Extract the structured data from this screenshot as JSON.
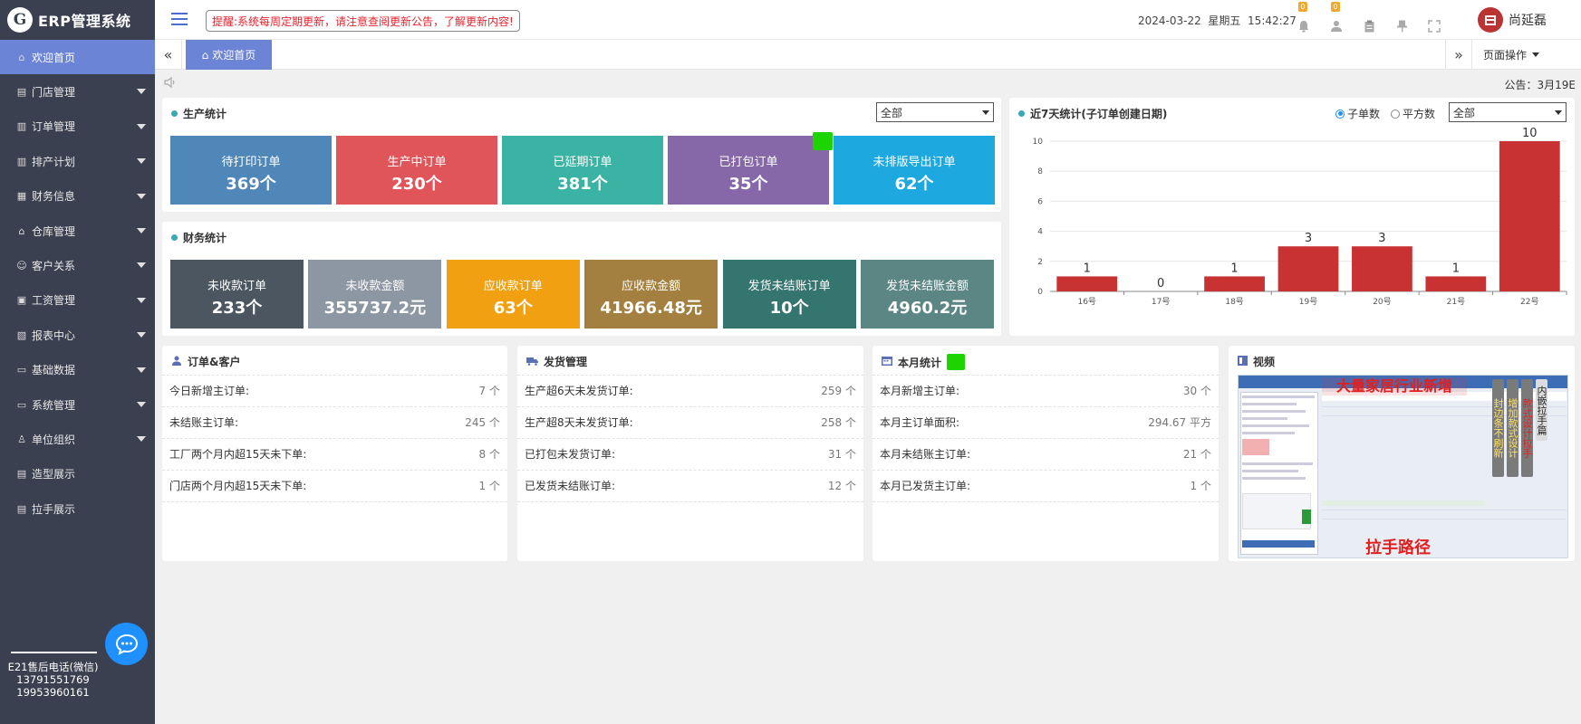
{
  "brand": {
    "logo_mark": "G",
    "name": "ERP管理系统"
  },
  "sidebar": {
    "items": [
      {
        "label": "欢迎首页",
        "icon": "home-icon",
        "active": true,
        "has_caret": false
      },
      {
        "label": "门店管理",
        "icon": "store-icon",
        "active": false,
        "has_caret": true
      },
      {
        "label": "订单管理",
        "icon": "document-icon",
        "active": false,
        "has_caret": true
      },
      {
        "label": "排产计划",
        "icon": "document-icon",
        "active": false,
        "has_caret": true
      },
      {
        "label": "财务信息",
        "icon": "finance-icon",
        "active": false,
        "has_caret": true
      },
      {
        "label": "仓库管理",
        "icon": "warehouse-icon",
        "active": false,
        "has_caret": true
      },
      {
        "label": "客户关系",
        "icon": "customer-icon",
        "active": false,
        "has_caret": true
      },
      {
        "label": "工资管理",
        "icon": "salary-icon",
        "active": false,
        "has_caret": true
      },
      {
        "label": "报表中心",
        "icon": "report-icon",
        "active": false,
        "has_caret": true
      },
      {
        "label": "基础数据",
        "icon": "monitor-icon",
        "active": false,
        "has_caret": true
      },
      {
        "label": "系统管理",
        "icon": "monitor-icon",
        "active": false,
        "has_caret": true
      },
      {
        "label": "单位组织",
        "icon": "user-icon",
        "active": false,
        "has_caret": true
      },
      {
        "label": "造型展示",
        "icon": "store-icon",
        "active": false,
        "has_caret": false
      },
      {
        "label": "拉手展示",
        "icon": "store-icon",
        "active": false,
        "has_caret": false
      }
    ],
    "support_title": "E21售后电话(微信)",
    "support_phone_1": "13791551769",
    "support_phone_2": "19953960161"
  },
  "topbar": {
    "notice": "提醒:系统每周定期更新，请注意查阅更新公告，了解更新内容!",
    "date": "2024-03-22",
    "weekday": "星期五",
    "time": "15:42:27",
    "icons": [
      {
        "name": "bell-icon",
        "badge": "0"
      },
      {
        "name": "user-icon",
        "badge": "0"
      },
      {
        "name": "clipboard-icon",
        "badge": ""
      },
      {
        "name": "pin-icon",
        "badge": ""
      },
      {
        "name": "fullscreen-icon",
        "badge": ""
      }
    ],
    "user_name": "尚延磊"
  },
  "tabs": {
    "active_label": "欢迎首页",
    "page_ops_label": "页面操作"
  },
  "announcement": "公告：3月19E",
  "production": {
    "title": "生产统计",
    "select_value": "全部",
    "tiles": [
      {
        "label": "待打印订单",
        "value": "369个",
        "color": "#4f87b8"
      },
      {
        "label": "生产中订单",
        "value": "230个",
        "color": "#e0555a"
      },
      {
        "label": "已延期订单",
        "value": "381个",
        "color": "#3bb3a4"
      },
      {
        "label": "已打包订单",
        "value": "35个",
        "color": "#8667a8"
      },
      {
        "label": "未排版导出订单",
        "value": "62个",
        "color": "#1ea8e0"
      }
    ]
  },
  "finance": {
    "title": "财务统计",
    "tiles": [
      {
        "label": "未收款订单",
        "value": "233个",
        "color": "#4b5660"
      },
      {
        "label": "未收款金额",
        "value": "355737.2元",
        "color": "#8d97a3"
      },
      {
        "label": "应收款订单",
        "value": "63个",
        "color": "#f0a010"
      },
      {
        "label": "应收款金额",
        "value": "41966.48元",
        "color": "#a3803f"
      },
      {
        "label": "发货未结账订单",
        "value": "10个",
        "color": "#357570"
      },
      {
        "label": "发货未结账金额",
        "value": "4960.2元",
        "color": "#5c8684"
      }
    ]
  },
  "chart_panel": {
    "title": "近7天统计(子订单创建日期)",
    "radio_1": "子单数",
    "radio_2": "平方数",
    "radio_selected": "子单数",
    "select_value": "全部"
  },
  "chart_data": {
    "type": "bar",
    "categories": [
      "16号",
      "17号",
      "18号",
      "19号",
      "20号",
      "21号",
      "22号"
    ],
    "values": [
      1,
      0,
      1,
      3,
      3,
      1,
      10
    ],
    "ylim": [
      0,
      10
    ],
    "yticks": [
      0,
      2,
      4,
      6,
      8,
      10
    ],
    "bar_color": "#c83232",
    "grid": true
  },
  "orders_customers": {
    "title": "订单&客户",
    "rows": [
      {
        "label": "今日新增主订单:",
        "value": "7 个"
      },
      {
        "label": "未结账主订单:",
        "value": "245 个"
      },
      {
        "label": "工厂两个月内超15天未下单:",
        "value": "8 个"
      },
      {
        "label": "门店两个月内超15天未下单:",
        "value": "1 个"
      }
    ]
  },
  "shipping": {
    "title": "发货管理",
    "rows": [
      {
        "label": "生产超6天未发货订单:",
        "value": "259 个"
      },
      {
        "label": "生产超8天未发货订单:",
        "value": "258 个"
      },
      {
        "label": "已打包未发货订单:",
        "value": "31 个"
      },
      {
        "label": "已发货未结账订单:",
        "value": "12 个"
      }
    ]
  },
  "monthly": {
    "title": "本月统计",
    "rows": [
      {
        "label": "本月新增主订单:",
        "value": "30 个"
      },
      {
        "label": "本月主订单面积:",
        "value": "294.67 平方"
      },
      {
        "label": "本月未结账主订单:",
        "value": "21 个"
      },
      {
        "label": "本月已发货主订单:",
        "value": "1 个"
      }
    ]
  },
  "video": {
    "title": "视频",
    "overlay_banner": "大量家居行业新增",
    "side_strip_1": "封边条不刷新",
    "side_strip_2": "增加款式设计",
    "side_strip_3": "款式设计拉手",
    "side_strip_4": "内嵌拉手篇",
    "caption": "拉手路径"
  }
}
